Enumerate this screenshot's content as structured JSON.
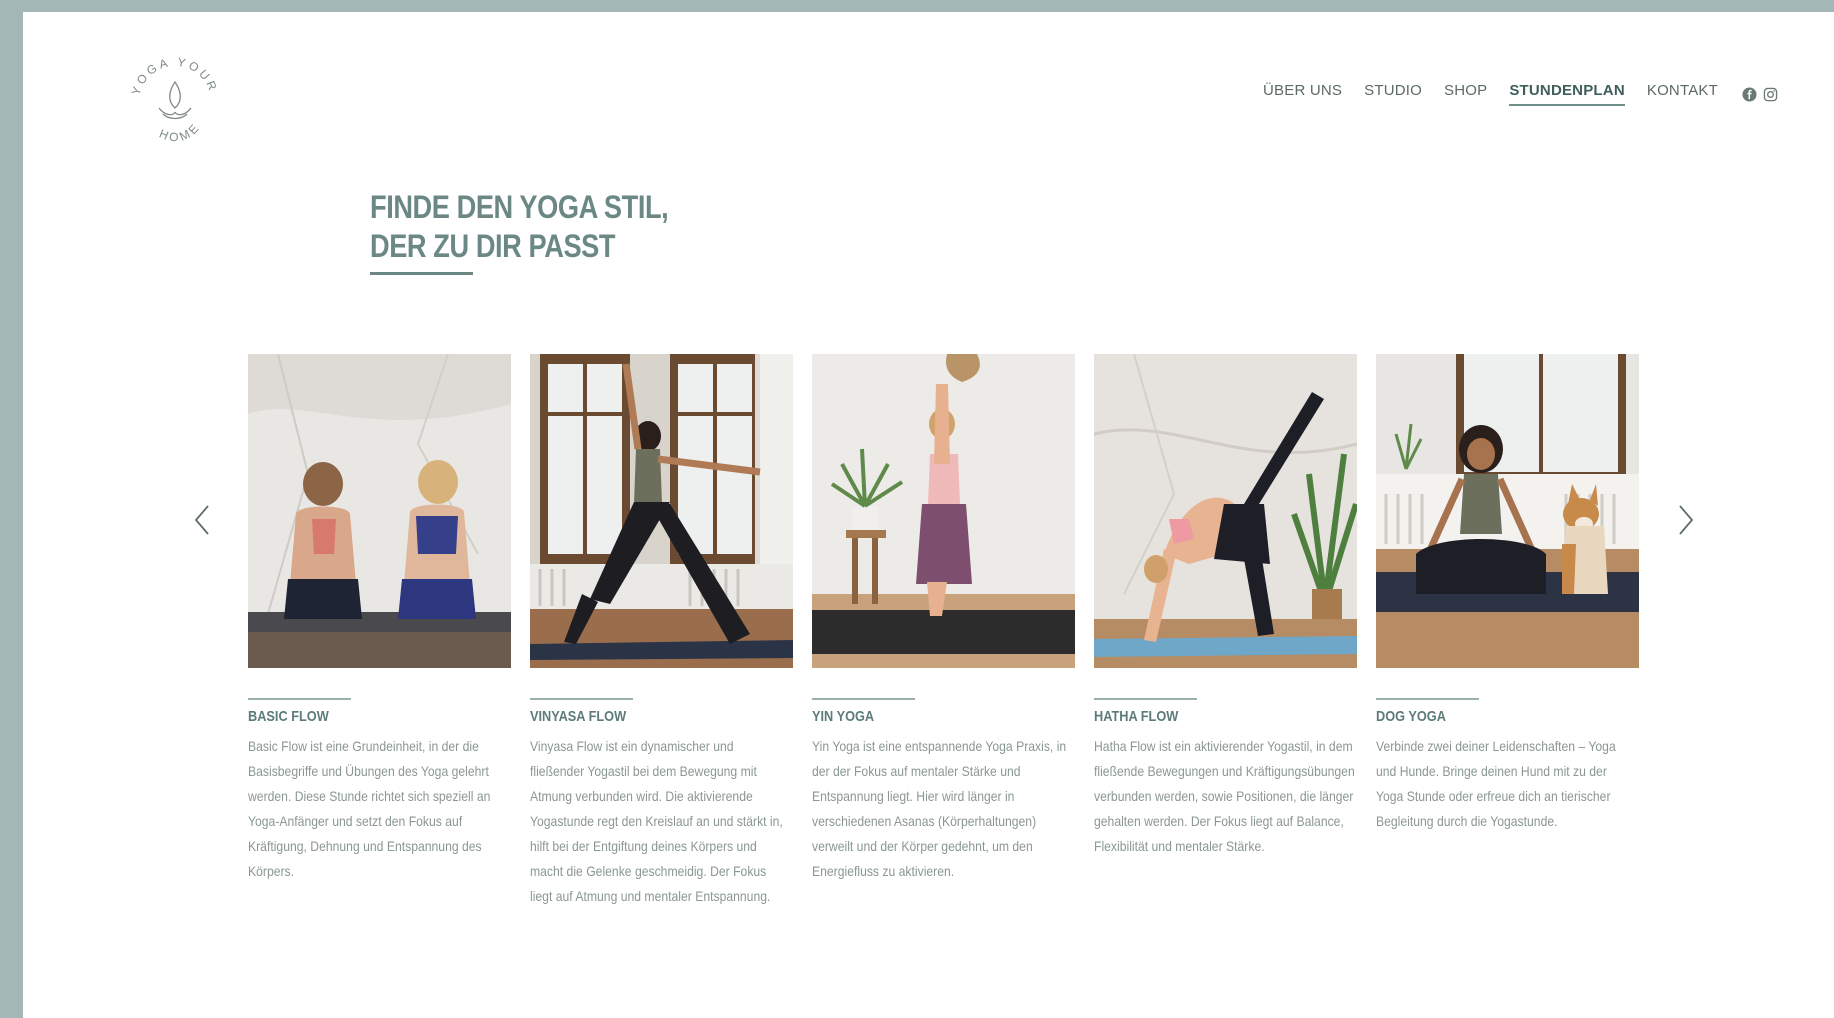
{
  "logo": {
    "text_top": "YOGA YOUR",
    "text_bottom": "HOME",
    "icon": "lotus-icon"
  },
  "nav": {
    "items": [
      {
        "label": "ÜBER UNS"
      },
      {
        "label": "STUDIO"
      },
      {
        "label": "SHOP"
      },
      {
        "label": "STUNDENPLAN",
        "active": true
      },
      {
        "label": "KONTAKT"
      }
    ],
    "social": [
      "facebook-icon",
      "instagram-icon"
    ]
  },
  "headline": {
    "line1": "FINDE DEN YOGA STIL,",
    "line2": "DER ZU DIR PASST"
  },
  "carousel": {
    "prev_icon": "chevron-left-icon",
    "next_icon": "chevron-right-icon",
    "cards": [
      {
        "title": "BASIC FLOW",
        "image": "two-women-kneeling-photo",
        "text": "Basic Flow ist eine Grundeinheit, in der die Basisbegriffe und Übungen des Yoga gelehrt werden. Diese Stunde richtet sich speziell an Yoga-Anfänger und setzt den Fokus auf Kräftigung, Dehnung und Entspannung des Körpers."
      },
      {
        "title": "VINYASA FLOW",
        "image": "warrior-pose-photo",
        "text": "Vinyasa Flow ist ein dynamischer und fließender Yogastil bei dem Bewegung mit Atmung verbunden wird. Die aktivierende Yogastunde regt den Kreislauf an und stärkt in, hilft bei der Entgiftung deines Körpers und macht die Gelenke geschmeidig. Der Fokus liegt auf Atmung und mentaler Entspannung."
      },
      {
        "title": "YIN YOGA",
        "image": "eagle-pose-photo",
        "text": "Yin Yoga ist eine entspannende Yoga Praxis, in der der Fokus auf mentaler Stärke und Entspannung liegt. Hier wird länger in verschiedenen Asanas (Körperhaltungen) verweilt und der Körper gedehnt, um den Energiefluss zu aktivieren."
      },
      {
        "title": "HATHA FLOW",
        "image": "wheel-pose-photo",
        "text": "Hatha Flow ist ein aktivierender Yogastil, in dem fließende Bewegungen und Kräftigungsübungen verbunden werden, sowie Positionen, die länger gehalten werden. Der Fokus liegt auf Balance, Flexibilität und mentaler Stärke."
      },
      {
        "title": "DOG YOGA",
        "image": "meditation-with-dog-photo",
        "text": "Verbinde zwei deiner Leidenschaften – Yoga und Hunde. Bringe deinen Hund mit zu der Yoga Stunde oder erfreue dich an tierischer Begleitung durch die Yogastunde."
      }
    ]
  },
  "colors": {
    "frame": "#a3b8b6",
    "accent": "#6c8884",
    "body_text": "#8a9794"
  }
}
